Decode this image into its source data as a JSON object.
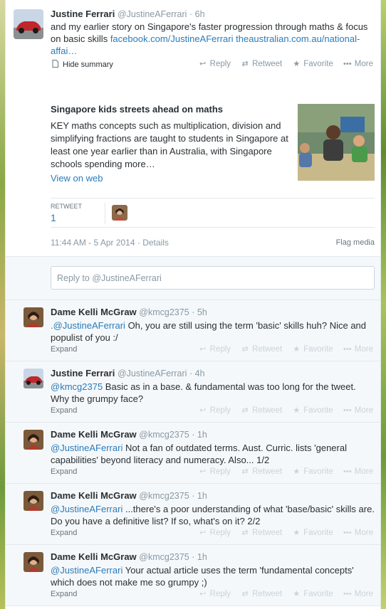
{
  "main_tweet": {
    "name": "Justine Ferrari",
    "handle": "@JustineAFerrari",
    "time": "· 6h",
    "text_plain": "and my earlier story on Singapore's faster progression through maths & focus on basic skills ",
    "text_link1": "facebook.com/JustineAFerrari",
    "text_link2": "theaustralian.com.au/national-affai…",
    "hide_summary": "Hide summary",
    "actions": {
      "reply": "Reply",
      "retweet": "Retweet",
      "favorite": "Favorite",
      "more": "More"
    },
    "card": {
      "title": "Singapore kids streets ahead on maths",
      "description": "KEY maths concepts such as multiplication, division and simplifying fractions are taught to students in Singapore at least one year earlier than in Australia, with Singapore schools spending more…",
      "view_link": "View on web"
    },
    "stats": {
      "label": "RETWEET",
      "value": "1"
    },
    "timestamp": "11:44 AM - 5 Apr 2014 · Details",
    "flag": "Flag media"
  },
  "reply_box": {
    "placeholder": "Reply to @JustineAFerrari"
  },
  "replies": [
    {
      "name": "Dame Kelli McGraw",
      "handle": "@kmcg2375",
      "time": "· 5h",
      "mention": ".@JustineAFerrari",
      "text": " Oh, you are still using the term 'basic' skills huh? Nice and populist of you :/",
      "expand": "Expand"
    },
    {
      "name": "Justine Ferrari",
      "handle": "@JustineAFerrari",
      "time": "· 4h",
      "mention": "@kmcg2375",
      "text": " Basic as in a base. & fundamental was too long for the tweet. Why the grumpy face?",
      "expand": "Expand"
    },
    {
      "name": "Dame Kelli McGraw",
      "handle": "@kmcg2375",
      "time": "· 1h",
      "mention": "@JustineAFerrari",
      "text": " Not a fan of outdated terms. Aust. Curric. lists 'general capabilities' beyond literacy and numeracy. Also... 1/2",
      "expand": "Expand"
    },
    {
      "name": "Dame Kelli McGraw",
      "handle": "@kmcg2375",
      "time": "· 1h",
      "mention": "@JustineAFerrari",
      "text": " ...there's a poor understanding of what 'base/basic' skills are. Do you have a definitive list? If so, what's on it? 2/2",
      "expand": "Expand"
    },
    {
      "name": "Dame Kelli McGraw",
      "handle": "@kmcg2375",
      "time": "· 1h",
      "mention": "@JustineAFerrari",
      "text": " Your actual article uses the term 'fundamental concepts' which does not make me so grumpy ;)",
      "expand": "Expand"
    }
  ],
  "colors": {
    "link": "#2b7bb9",
    "muted": "#8899a6",
    "reply_bg": "#f5f8fa"
  }
}
